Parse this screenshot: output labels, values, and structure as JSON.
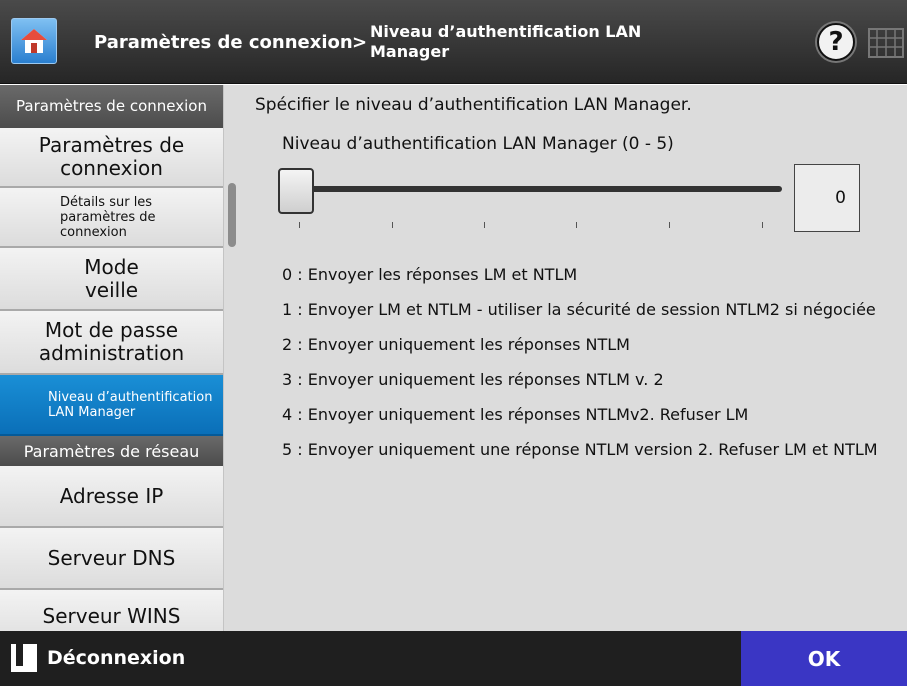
{
  "header": {
    "home_icon": "home-icon",
    "section": "Paramètres de connexion",
    "separator": ">",
    "page_title": "Niveau d’authentification LAN Manager",
    "help_label": "?",
    "keyboard_icon": "keyboard-icon"
  },
  "sidebar": {
    "group1_header": "Paramètres de connexion",
    "items": [
      {
        "label": "Paramètres de connexion"
      },
      {
        "label": "Détails sur les paramètres de connexion"
      },
      {
        "label": "Mode veille"
      },
      {
        "label": "Mot de passe administration"
      },
      {
        "label": "Niveau d’authentification LAN Manager",
        "active": true
      }
    ],
    "group2_header": "Paramètres de réseau",
    "network_items": [
      {
        "label": "Adresse IP"
      },
      {
        "label": "Serveur DNS"
      },
      {
        "label": "Serveur WINS"
      }
    ]
  },
  "main": {
    "instruction": "Spécifier le niveau d’authentification LAN Manager.",
    "slider_label": "Niveau d’authentification LAN Manager (0 - 5)",
    "slider_min": 0,
    "slider_max": 5,
    "value": "0",
    "options": [
      "0 : Envoyer les réponses LM et NTLM",
      "1 : Envoyer LM et NTLM - utiliser la sécurité de session NTLM2 si négociée",
      "2 : Envoyer uniquement les réponses NTLM",
      "3 : Envoyer uniquement les réponses NTLM v. 2",
      "4 : Envoyer uniquement les réponses NTLMv2. Refuser LM",
      "5 : Envoyer uniquement une réponse NTLM version 2. Refuser LM et NTLM"
    ]
  },
  "footer": {
    "logout_label": "Déconnexion",
    "logout_icon": "logout-icon",
    "ok_label": "OK"
  },
  "colors": {
    "header_bg": "#333333",
    "active_item": "#0a7dc8",
    "ok_button": "#3a36c4",
    "content_bg": "#dcdcdc"
  }
}
